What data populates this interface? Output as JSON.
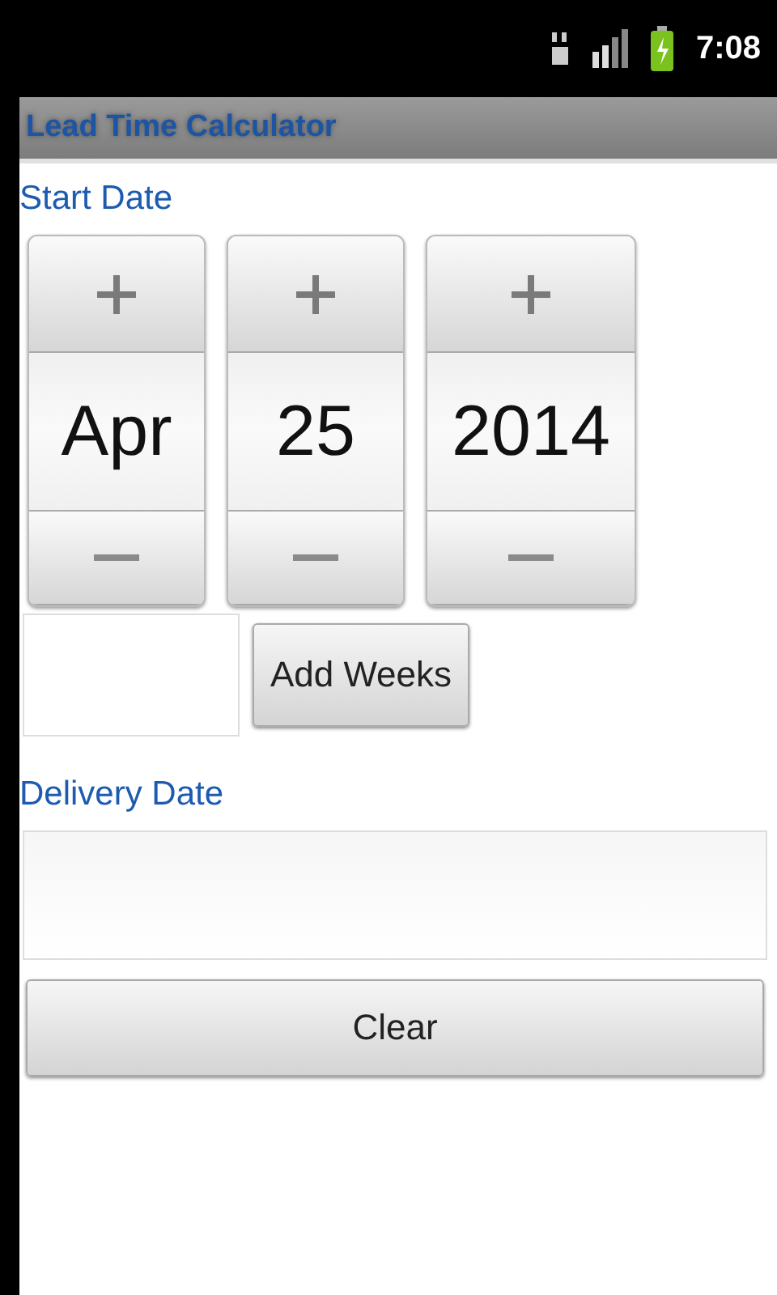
{
  "status_bar": {
    "time": "7:08"
  },
  "title_bar": {
    "title": "Lead Time Calculator"
  },
  "start_date": {
    "label": "Start Date",
    "spinners": [
      {
        "value": "Apr"
      },
      {
        "value": "25"
      },
      {
        "value": "2014"
      }
    ]
  },
  "add_weeks_button": "Add Weeks",
  "delivery_date": {
    "label": "Delivery Date"
  },
  "clear_button": "Clear"
}
